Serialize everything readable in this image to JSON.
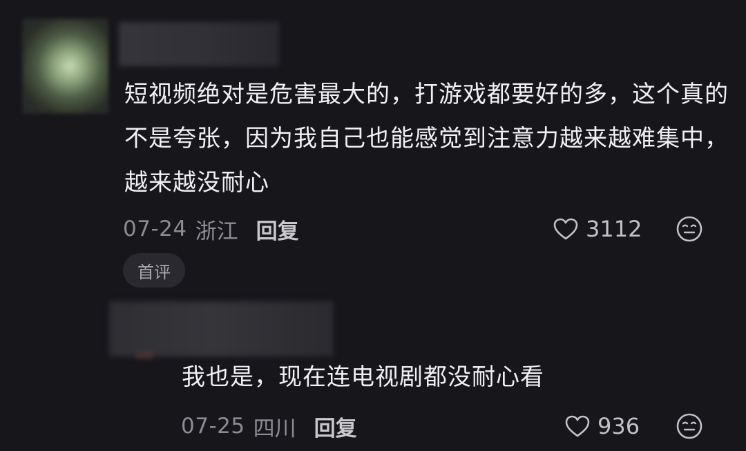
{
  "comments": [
    {
      "text": "短视频绝对是危害最大的，打游戏都要好的多，这个真的不是夸张，因为我自己也能感觉到注意力越来越难集中，越来越没耐心",
      "date": "07-24",
      "location": "浙江",
      "reply_label": "回复",
      "likes": "3112",
      "badge": "首评"
    }
  ],
  "replies": [
    {
      "text": "我也是，现在连电视剧都没耐心看",
      "date": "07-25",
      "location": "四川",
      "reply_label": "回复",
      "likes": "936"
    }
  ],
  "icons": {
    "like": "heart-outline-icon",
    "emoji": "emoji-face-icon"
  },
  "colors": {
    "background": "#17161b",
    "text": "#f1f1f3",
    "muted": "#8d8c92"
  }
}
